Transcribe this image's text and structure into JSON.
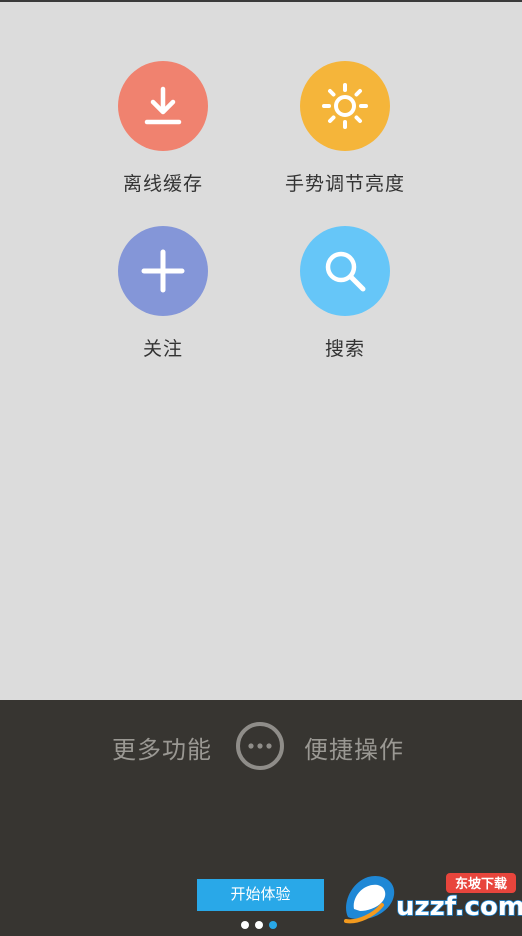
{
  "features": [
    {
      "label": "离线缓存",
      "icon": "download-icon",
      "color": "#f0826f"
    },
    {
      "label": "手势调节亮度",
      "icon": "sun-icon",
      "color": "#f5b53a"
    },
    {
      "label": "关注",
      "icon": "plus-icon",
      "color": "#8496d8"
    },
    {
      "label": "搜索",
      "icon": "search-icon",
      "color": "#66c6f8"
    }
  ],
  "more": {
    "left_label": "更多功能",
    "right_label": "便捷操作",
    "icon": "more-dots-icon"
  },
  "start_button": {
    "label": "开始体验",
    "color": "#29a8e8"
  },
  "pager": {
    "count": 3,
    "active_index": 2,
    "active_color": "#29a8e8",
    "inactive_color": "#ffffff"
  },
  "watermark": {
    "brand": "uzzf.com",
    "tagline": "东坡下载"
  }
}
